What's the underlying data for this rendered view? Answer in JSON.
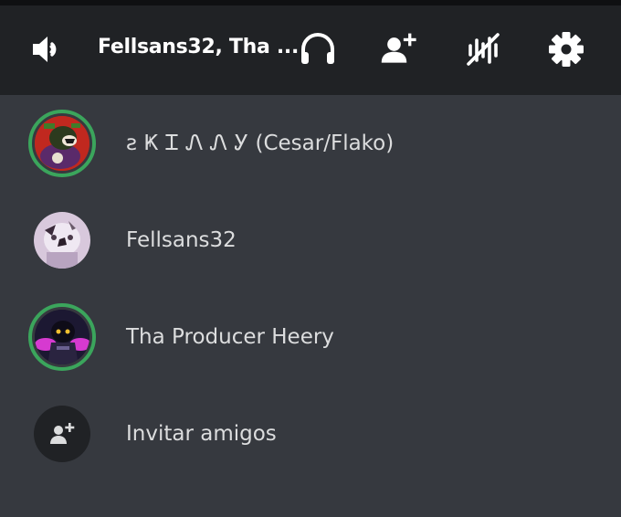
{
  "header": {
    "title": "Fellsans32, Tha ...",
    "icons": [
      "speaker-icon",
      "headphones-icon",
      "add-friend-icon",
      "noise-suppression-icon",
      "gear-icon"
    ]
  },
  "members": [
    {
      "name": "ꙅ Ҝ Ꮖ Ꮑ Ꮑ Ꭹ (Cesar/Flako)",
      "speaking": true
    },
    {
      "name": "Fellsans32",
      "speaking": false
    },
    {
      "name": "Tha Producer Heery",
      "speaking": true
    }
  ],
  "invite": {
    "label": "Invitar amigos"
  },
  "colors": {
    "header_bg": "#202225",
    "list_bg": "#36393f",
    "speaking_ring": "#3ba55c",
    "text": "#dcddde"
  }
}
